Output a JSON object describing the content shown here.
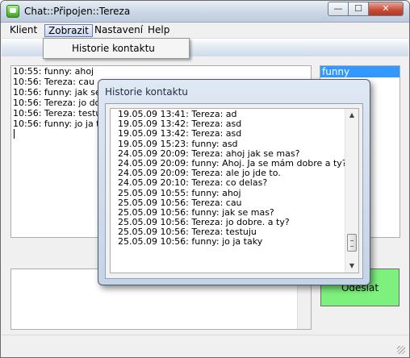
{
  "window": {
    "title": "Chat::Připojen::Tereza",
    "controls": {
      "minimize": "—",
      "maximize": "☐",
      "close": "✕"
    },
    "icon": "chat-app-icon"
  },
  "menu": {
    "items": [
      {
        "label": "Klient"
      },
      {
        "label": "Zobrazit",
        "active": true
      },
      {
        "label": "Nastavení"
      },
      {
        "label": "Help"
      }
    ],
    "dropdown": {
      "items": [
        {
          "label": "Historie kontaktu"
        }
      ]
    }
  },
  "chat": {
    "lines": [
      "10:55: funny: ahoj",
      "10:56: Tereza: cau",
      "10:56: funny: jak se m",
      "10:56: Tereza: jo dobr",
      "10:56: Tereza: testuj",
      "10:56: funny: jo ja tak"
    ]
  },
  "contacts": {
    "items": [
      {
        "label": "funny",
        "selected": true
      }
    ]
  },
  "send_button": {
    "label": "Odeslat",
    "color": "#7ef07e"
  },
  "history_dialog": {
    "title": "Historie kontaktu",
    "lines": [
      "19.05.09 13:41: Tereza: ad",
      "19.05.09 13:42: Tereza: asd",
      "19.05.09 13:42: Tereza: asd",
      "19.05.09 15:23: funny: asd",
      "24.05.09 20:09: Tereza: ahoj jak se mas?",
      "24.05.09 20:09: funny: Ahoj. Ja se mám dobre a ty?",
      "24.05.09 20:09: Tereza: ale jo jde to.",
      "24.05.09 20:10: Tereza: co delas?",
      "25.05.09 10:55: funny: ahoj",
      "25.05.09 10:56: Tereza: cau",
      "25.05.09 10:56: funny: jak se mas?",
      "25.05.09 10:56: Tereza: jo dobre. a ty?",
      "25.05.09 10:56: Tereza: testuju",
      "25.05.09 10:56: funny: jo ja taky"
    ],
    "scrollbar": {
      "up": "▲",
      "down": "▼"
    }
  },
  "colors": {
    "selection": "#3399ff",
    "send": "#7ef07e"
  }
}
